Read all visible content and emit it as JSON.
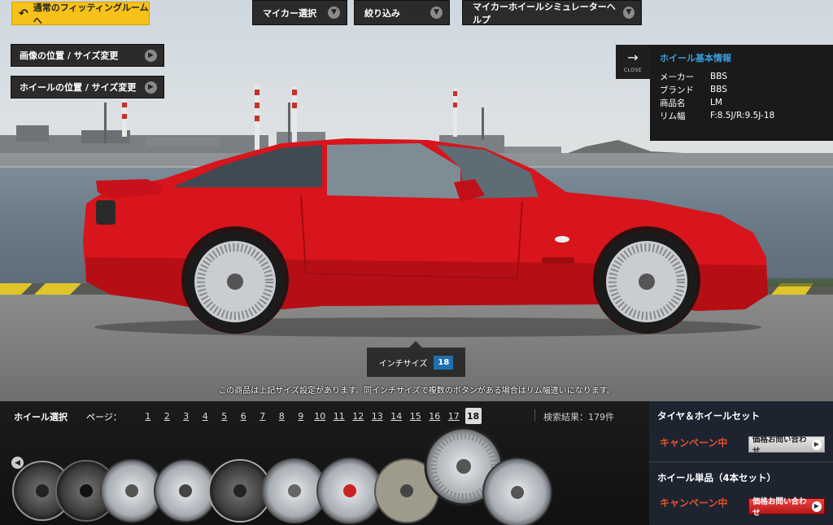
{
  "header": {
    "fitting_button": "通常のフィッティングルームへ",
    "my_car_select": "マイカー選択",
    "filter": "絞り込み",
    "help": "マイカーホイールシミュレーターヘルプ"
  },
  "side_buttons": {
    "image_position": "画像の位置 / サイズ変更",
    "wheel_position": "ホイールの位置 / サイズ変更"
  },
  "info": {
    "close_label": "CLOSE",
    "title": "ホイール基本情報",
    "rows": [
      {
        "key": "メーカー",
        "value": "BBS"
      },
      {
        "key": "ブランド",
        "value": "BBS"
      },
      {
        "key": "商品名",
        "value": "LM"
      },
      {
        "key": "リム幅",
        "value": "F:8.5J/R:9.5J-18"
      }
    ]
  },
  "inch": {
    "label": "インチサイズ",
    "value": "18"
  },
  "note": "この商品は上記サイズ設定があります。同インチサイズで複数のボタンがある場合はリム幅違いになります。",
  "wheel_select": {
    "label": "ホイール選択",
    "page_label": "ページ：",
    "pages": [
      "1",
      "2",
      "3",
      "4",
      "5",
      "6",
      "7",
      "8",
      "9",
      "10",
      "11",
      "12",
      "13",
      "14",
      "15",
      "16",
      "17",
      "18"
    ],
    "active_page": "18",
    "results": "検索結果：179件"
  },
  "right_panel": {
    "tire_wheel_set": "タイヤ＆ホイールセット",
    "campaign_1": "キャンペーン中",
    "price_button_1": "価格お問い合わせ",
    "wheel_only": "ホイール単品（4本セット）",
    "campaign_2": "キャンペーン中",
    "price_button_2": "価格お問い合わせ"
  },
  "colors": {
    "accent_yellow": "#f6c21a",
    "info_title_blue": "#3aa0e0",
    "campaign_orange": "#e8502a",
    "car_red": "#d8141c"
  }
}
